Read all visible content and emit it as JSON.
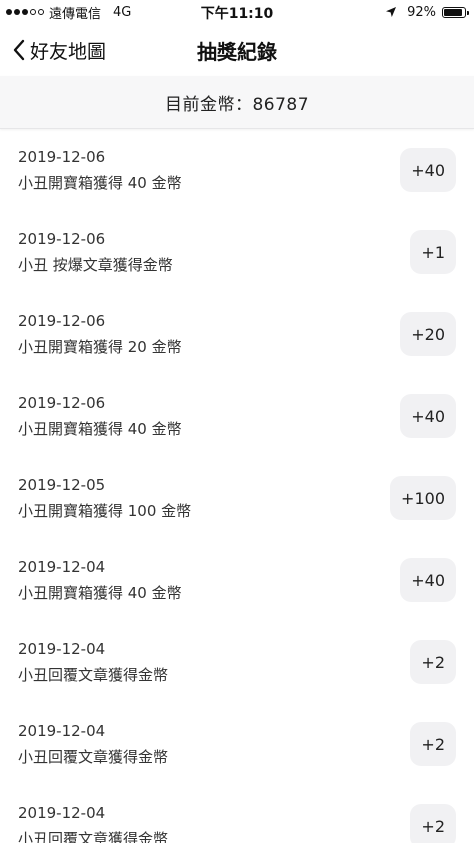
{
  "status_bar": {
    "carrier": "遠傳電信",
    "network": "4G",
    "time": "下午11:10",
    "battery_percent_label": "92%",
    "battery_level": 0.92,
    "signal_bars_filled": 3,
    "signal_bars_total": 5,
    "icons": [
      "location-arrow-icon",
      "battery-icon"
    ]
  },
  "nav": {
    "back_label": "好友地圖",
    "back_icon": "chevron-left-icon",
    "title": "抽獎紀錄"
  },
  "balance": {
    "text": "目前金幣：86787"
  },
  "records": [
    {
      "date": "2019-12-06",
      "desc": "小丑開寶箱獲得 40 金幣",
      "amount": "+40"
    },
    {
      "date": "2019-12-06",
      "desc": "小丑 按爆文章獲得金幣",
      "amount": "+1"
    },
    {
      "date": "2019-12-06",
      "desc": "小丑開寶箱獲得 20 金幣",
      "amount": "+20"
    },
    {
      "date": "2019-12-06",
      "desc": "小丑開寶箱獲得 40 金幣",
      "amount": "+40"
    },
    {
      "date": "2019-12-05",
      "desc": "小丑開寶箱獲得 100 金幣",
      "amount": "+100"
    },
    {
      "date": "2019-12-04",
      "desc": "小丑開寶箱獲得 40 金幣",
      "amount": "+40"
    },
    {
      "date": "2019-12-04",
      "desc": "小丑回覆文章獲得金幣",
      "amount": "+2"
    },
    {
      "date": "2019-12-04",
      "desc": "小丑回覆文章獲得金幣",
      "amount": "+2"
    },
    {
      "date": "2019-12-04",
      "desc": "小丑回覆文章獲得金幣",
      "amount": "+2"
    }
  ],
  "colors": {
    "background": "#ffffff",
    "header_bg": "#f7f7f8",
    "badge_bg": "#f1f1f3",
    "text": "#222222"
  }
}
